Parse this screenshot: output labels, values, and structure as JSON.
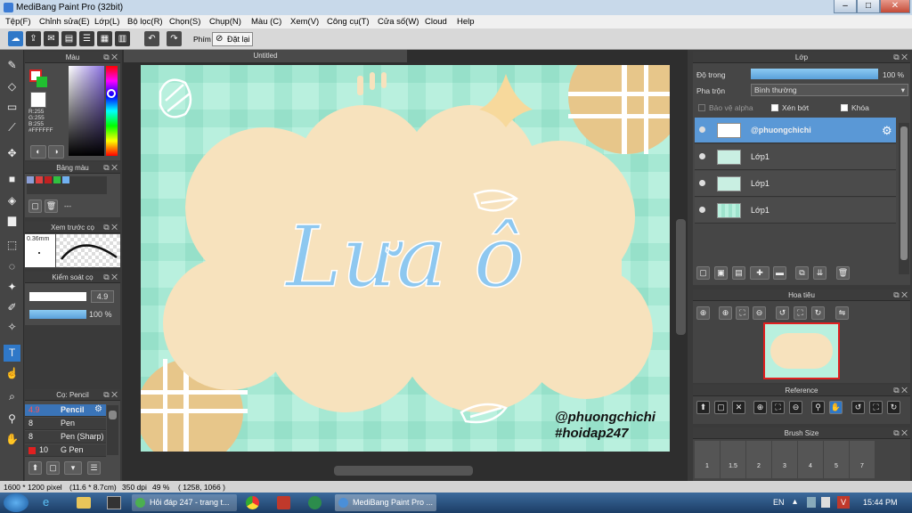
{
  "window": {
    "title": "MediBang Paint Pro (32bit)",
    "min": "–",
    "max": "□",
    "close": "✕"
  },
  "menu": [
    "Tệp(F)",
    "Chỉnh sửa(E)",
    "Lớp(L)",
    "Bộ lọc(R)",
    "Chọn(S)",
    "Chụp(N)",
    "Màu (C)",
    "Xem(V)",
    "Công cụ(T)",
    "Cửa số(W)",
    "Cloud",
    "Help"
  ],
  "toolbar": {
    "key_label": "Phím",
    "reset_label": "Đặt lại"
  },
  "color_panel": {
    "title": "Màu",
    "r": "R:255",
    "g": "G:255",
    "b": "B:255",
    "hex": "#FFFFFF"
  },
  "palette_panel": {
    "title": "Bảng màu",
    "label": "---"
  },
  "preview_panel": {
    "title": "Xem trước cọ",
    "size": "0.36mm"
  },
  "control_panel": {
    "title": "Kiểm soát cọ",
    "size_value": "4.9",
    "opacity_value": "100 %"
  },
  "brush_panel": {
    "title": "Cọ: Pencil",
    "items": [
      {
        "size": "4.9",
        "name": "Pencil"
      },
      {
        "size": "8",
        "name": "Pen"
      },
      {
        "size": "8",
        "name": "Pen (Sharp)"
      },
      {
        "size": "10",
        "name": "G Pen"
      }
    ]
  },
  "canvas": {
    "tab_title": "Untitled",
    "lettering": "Lưa ô",
    "credit": "@phuongchichi",
    "hashtag": "#hoidap247"
  },
  "layer_panel": {
    "title": "Lớp",
    "opacity_label": "Độ trong",
    "opacity_value": "100 %",
    "blend_label": "Pha trộn",
    "blend_value": "Bình thường",
    "protect_alpha": "Bảo vệ alpha",
    "clipping": "Xén bớt",
    "lock": "Khóa",
    "layers": [
      {
        "name": "@phuongchichi",
        "selected": true
      },
      {
        "name": "Lớp1",
        "selected": false
      },
      {
        "name": "Lớp1",
        "selected": false
      },
      {
        "name": "Lớp1",
        "selected": false
      }
    ]
  },
  "navigator_panel": {
    "title": "Hoa tiêu"
  },
  "reference_panel": {
    "title": "Reference"
  },
  "brushsize_panel": {
    "title": "Brush Size",
    "sizes": [
      "1",
      "1.5",
      "2",
      "3",
      "4",
      "5",
      "7"
    ]
  },
  "status": {
    "dimensions": "1600 * 1200 pixel",
    "physical": "(11.6 * 8.7cm)",
    "dpi": "350 dpi",
    "zoom": "49 %",
    "coords": "( 1258, 1066 )"
  },
  "taskbar": {
    "items": [
      "Hỏi đáp 247 - trang t...",
      "MediBang Paint Pro ..."
    ],
    "lang": "EN",
    "clock": "15:44 PM"
  },
  "colors": {
    "bg_mint": "#b9f0de",
    "cloud": "#f7e2bd",
    "orange_circle": "#e7c68a",
    "letter_blue": "#8ec8f0",
    "selection": "#5a98d6"
  }
}
